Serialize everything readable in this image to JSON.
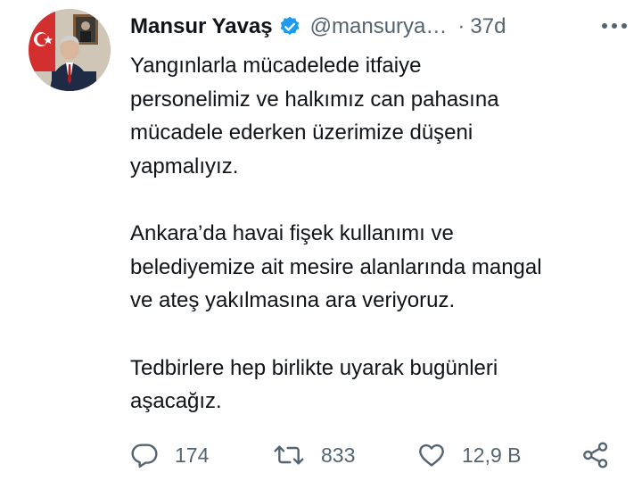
{
  "author": {
    "name": "Mansur Yavaş",
    "handle": "@mansurya…",
    "separator": "·",
    "time": "37d",
    "verified": true,
    "avatar_icon": "profile-photo"
  },
  "tweet": {
    "paragraphs": [
      {
        "lines": [
          "Yangınlarla mücadelede itfaiye",
          "personelimiz ve halkımız can pahasına",
          "mücadele ederken üzerimize düşeni",
          "yapmalıyız."
        ]
      },
      {
        "lines": [
          "Ankara’da havai fişek kullanımı ve",
          "belediyemize ait mesire alanlarında mangal",
          "ve ateş yakılmasına ara veriyoruz."
        ]
      },
      {
        "lines": [
          "Tedbirlere hep birlikte uyarak bugünleri",
          "aşacağız."
        ]
      }
    ]
  },
  "actions": {
    "reply": {
      "icon": "reply-icon",
      "count": "174"
    },
    "retweet": {
      "icon": "retweet-icon",
      "count": "833"
    },
    "like": {
      "icon": "heart-icon",
      "count": "12,9 B"
    },
    "share": {
      "icon": "share-icon"
    }
  },
  "colors": {
    "text": "#0f1419",
    "secondary": "#536471",
    "verified": "#1d9bf0"
  }
}
